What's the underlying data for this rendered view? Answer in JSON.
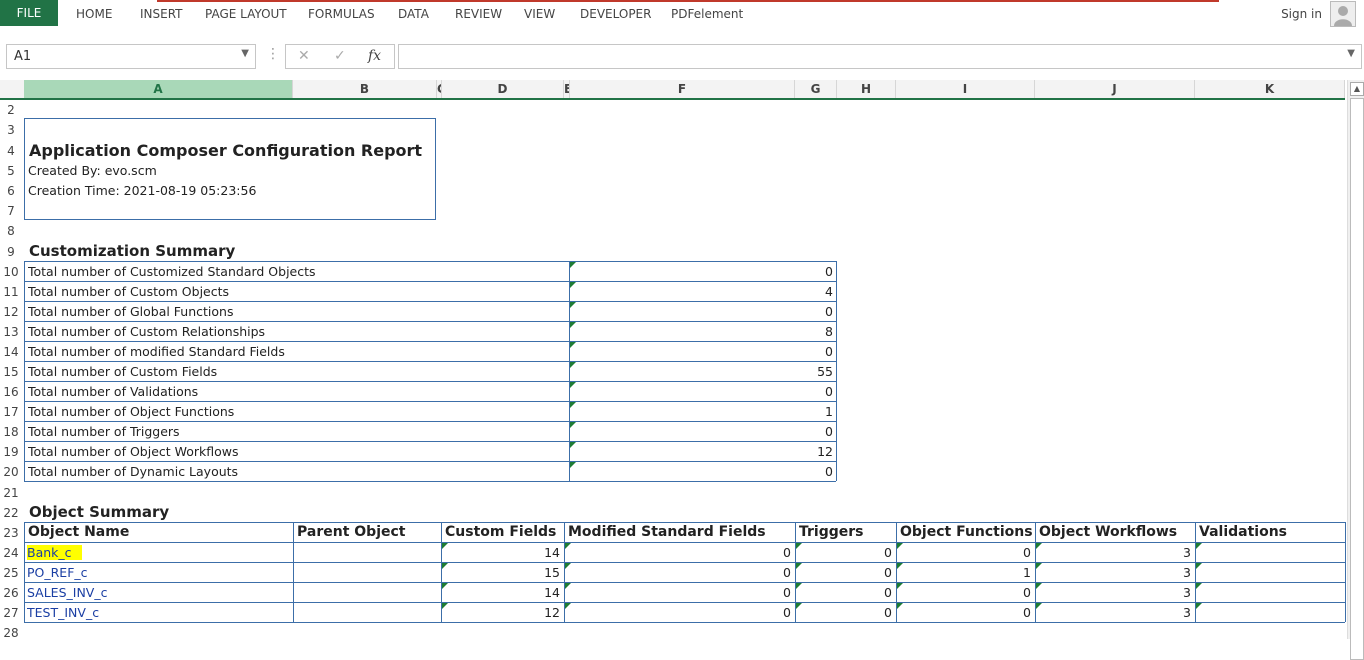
{
  "ribbon": {
    "file": "FILE",
    "tabs": [
      "HOME",
      "INSERT",
      "PAGE LAYOUT",
      "FORMULAS",
      "DATA",
      "REVIEW",
      "VIEW",
      "DEVELOPER",
      "PDFelement"
    ],
    "sign_in": "Sign in"
  },
  "formula_bar": {
    "name_box": "A1",
    "cancel": "✕",
    "enter": "✓",
    "fx": "fx",
    "formula": ""
  },
  "columns": [
    "A",
    "B",
    "C",
    "D",
    "E",
    "F",
    "G",
    "H",
    "I",
    "J",
    "K"
  ],
  "rows": [
    "2",
    "3",
    "4",
    "5",
    "6",
    "7",
    "8",
    "9",
    "10",
    "11",
    "12",
    "13",
    "14",
    "15",
    "16",
    "17",
    "18",
    "19",
    "20",
    "21",
    "22",
    "23",
    "24",
    "25",
    "26",
    "27",
    "28"
  ],
  "report": {
    "title": "Application Composer Configuration Report",
    "created_by": "Created By: evo.scm",
    "creation_time": "Creation Time: 2021-08-19 05:23:56"
  },
  "customization_summary": {
    "heading": "Customization Summary",
    "items": [
      {
        "label": "Total number of Customized Standard Objects",
        "value": "0"
      },
      {
        "label": "Total number of Custom Objects",
        "value": "4"
      },
      {
        "label": "Total number of Global Functions",
        "value": "0"
      },
      {
        "label": "Total number of Custom Relationships",
        "value": "8"
      },
      {
        "label": "Total number of modified Standard Fields",
        "value": "0"
      },
      {
        "label": "Total number of Custom Fields",
        "value": "55"
      },
      {
        "label": "Total number of  Validations",
        "value": "0"
      },
      {
        "label": "Total number of Object Functions",
        "value": "1"
      },
      {
        "label": "Total number of Triggers",
        "value": "0"
      },
      {
        "label": "Total number of Object Workflows",
        "value": "12"
      },
      {
        "label": "Total number of Dynamic Layouts",
        "value": "0"
      }
    ]
  },
  "object_summary": {
    "heading": "Object Summary",
    "columns": [
      "Object Name",
      "Parent Object",
      "Custom Fields",
      "Modified Standard Fields",
      "Triggers",
      "Object Functions",
      "Object Workflows",
      "Validations"
    ],
    "rows": [
      {
        "name": "Bank_c",
        "parent": "",
        "custom_fields": "14",
        "modified": "0",
        "triggers": "0",
        "functions": "0",
        "workflows": "3",
        "validations": ""
      },
      {
        "name": "PO_REF_c",
        "parent": "",
        "custom_fields": "15",
        "modified": "0",
        "triggers": "0",
        "functions": "1",
        "workflows": "3",
        "validations": ""
      },
      {
        "name": "SALES_INV_c",
        "parent": "",
        "custom_fields": "14",
        "modified": "0",
        "triggers": "0",
        "functions": "0",
        "workflows": "3",
        "validations": ""
      },
      {
        "name": "TEST_INV_c",
        "parent": "",
        "custom_fields": "12",
        "modified": "0",
        "triggers": "0",
        "functions": "0",
        "workflows": "3",
        "validations": ""
      }
    ]
  },
  "colors": {
    "accent": "#217346",
    "border": "#3c6ea8",
    "highlight": "#ffff00",
    "link": "#1a3ea3"
  }
}
